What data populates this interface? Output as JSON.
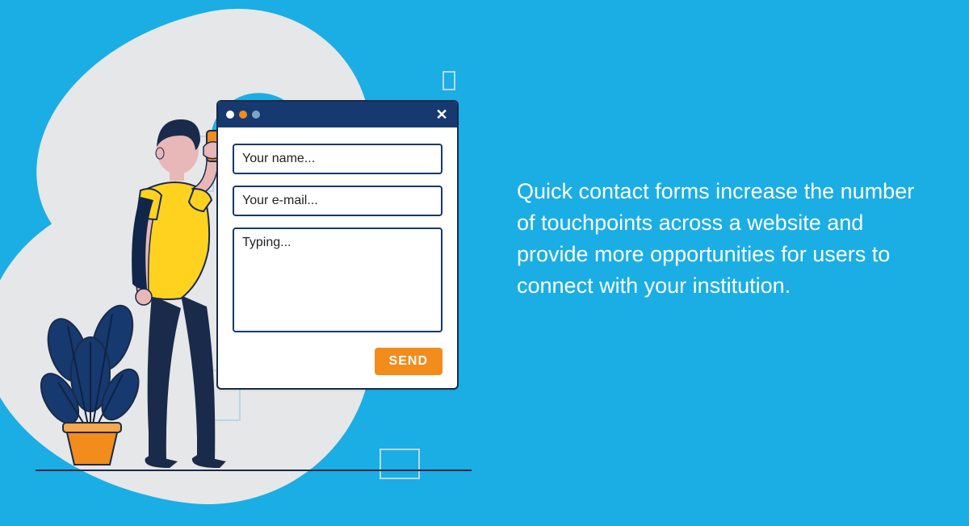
{
  "form": {
    "name_placeholder": "Your name...",
    "email_placeholder": "Your e-mail...",
    "message_placeholder": "Typing...",
    "send_label": "SEND"
  },
  "copy": {
    "body": "Quick contact forms increase the number of touchpoints across a website and provide more opportunities for users to connect with your institution."
  }
}
